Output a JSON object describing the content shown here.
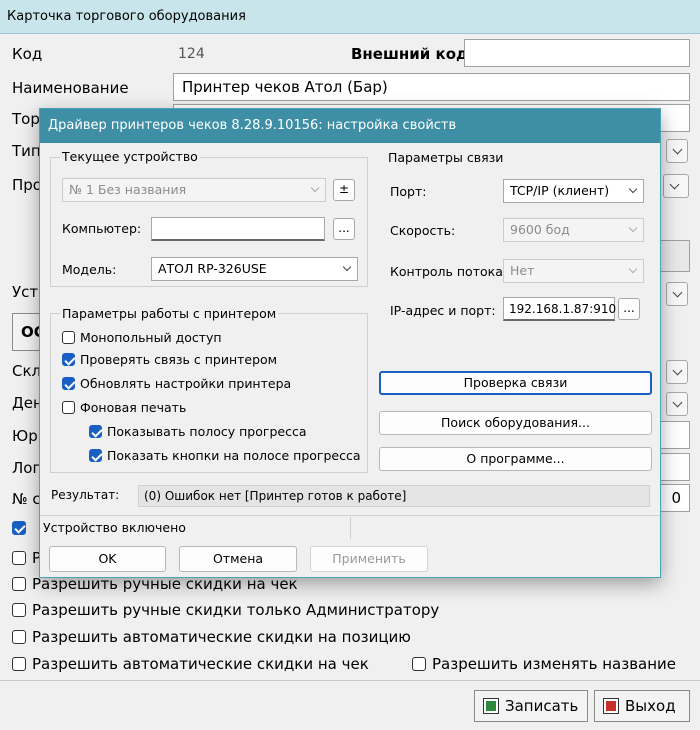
{
  "window": {
    "title": "Карточка торгового оборудования"
  },
  "form": {
    "code_label": "Код",
    "code_value": "124",
    "external_code_label": "Внешний код",
    "external_code_value": "",
    "name_label": "Наименование",
    "name_value": "Принтер чеков Атол (Бар)",
    "partial_labels": [
      "Тор",
      "Тип",
      "Про",
      "Уст",
      "Скл",
      "Ден",
      "Юри",
      "Лог",
      "№ с"
    ],
    "partial_button": "ОС",
    "counter_value": "0"
  },
  "checkboxes": [
    {
      "label": "Устройство включено",
      "checked": true
    },
    {
      "label": "Р",
      "checked": false
    },
    {
      "label": "Разрешить ручные скидки на чек",
      "checked": false
    },
    {
      "label": "Разрешить ручные скидки только Администратору",
      "checked": false
    },
    {
      "label": "Разрешить автоматические скидки на позицию",
      "checked": false
    },
    {
      "label": "Разрешить автоматические скидки на чек",
      "checked": false
    },
    {
      "label": "Разрешить изменять название",
      "checked": false
    }
  ],
  "footer": {
    "save_label": "Записать",
    "exit_label": "Выход"
  },
  "dialog": {
    "title": "Драйвер принтеров чеков 8.28.9.10156: настройка свойств",
    "device_group": {
      "title": "Текущее устройство",
      "device_value": "№ 1 Без названия",
      "plusminus": "±",
      "computer_label": "Компьютер:",
      "computer_value": "",
      "browse": "...",
      "model_label": "Модель:",
      "model_value": "АТОЛ RP-326USE"
    },
    "printer_group": {
      "title": "Параметры работы с принтером",
      "options": [
        {
          "label": "Монопольный доступ",
          "checked": false
        },
        {
          "label": "Проверять связь с принтером",
          "checked": true
        },
        {
          "label": "Обновлять настройки принтера",
          "checked": true
        },
        {
          "label": "Фоновая печать",
          "checked": false
        },
        {
          "label": "Показывать полосу прогресса",
          "checked": true
        },
        {
          "label": "Показать кнопки на полосе прогресса",
          "checked": true
        }
      ]
    },
    "conn_group": {
      "title": "Параметры связи",
      "port_label": "Порт:",
      "port_value": "TCP/IP (клиент)",
      "speed_label": "Скорость:",
      "speed_value": "9600 бод",
      "flow_label": "Контроль потока:",
      "flow_value": "Нет",
      "ip_label": "IP-адрес и порт:",
      "ip_value": "192.168.1.87:910",
      "browse": "..."
    },
    "buttons": {
      "check": "Проверка связи",
      "search": "Поиск оборудования...",
      "about": "О программе...",
      "ok": "OK",
      "cancel": "Отмена",
      "apply": "Применить"
    },
    "result_label": "Результат:",
    "result_value": "(0) Ошибок нет  [Принтер готов к работе]"
  }
}
